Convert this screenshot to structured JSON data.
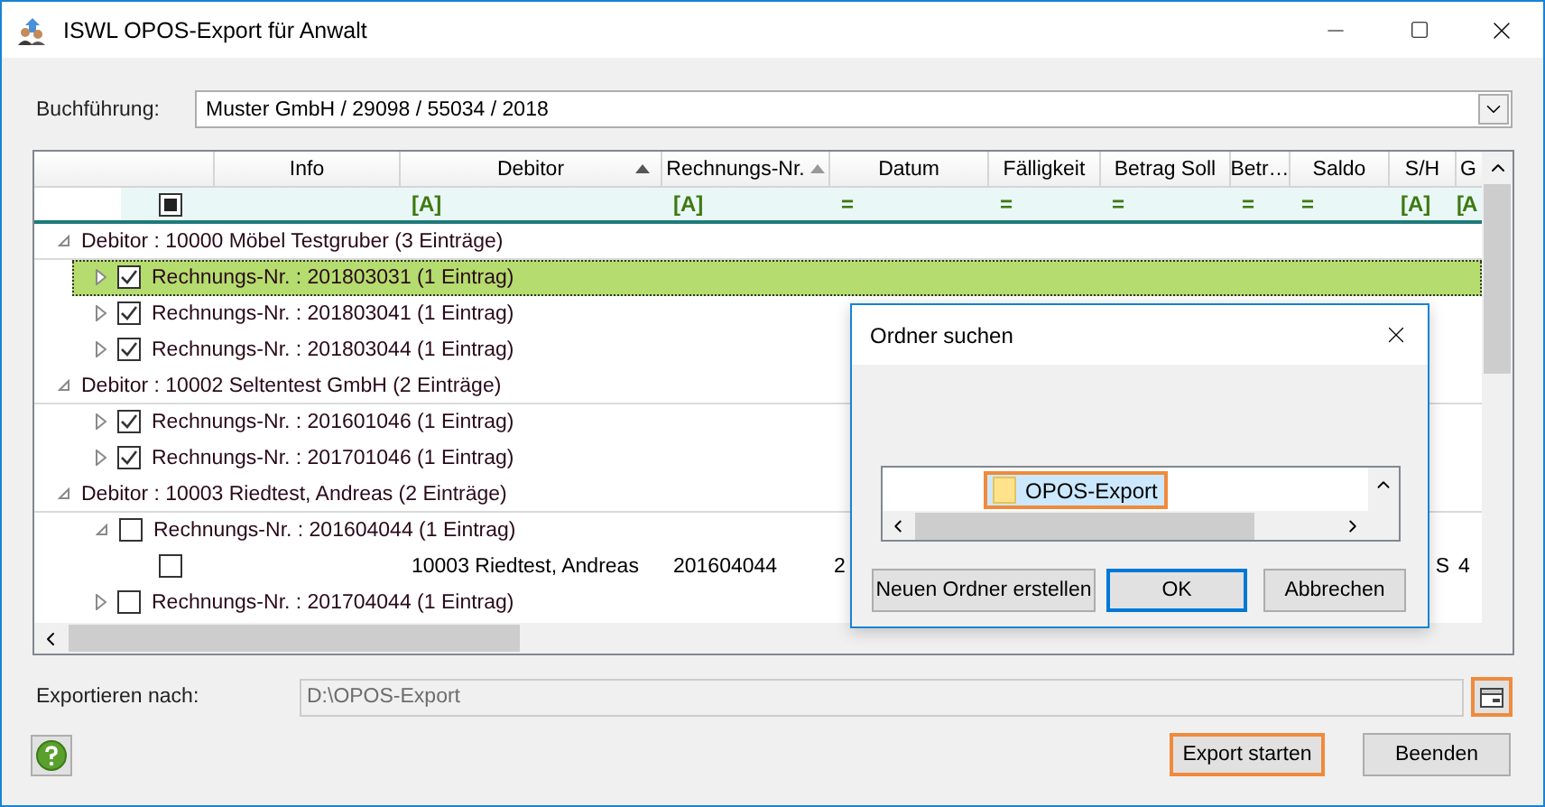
{
  "window": {
    "title": "ISWL OPOS-Export für Anwalt"
  },
  "accounting": {
    "label": "Buchführung:",
    "value": "Muster GmbH / 29098 / 55034 / 2018"
  },
  "grid": {
    "select_all_partial": true,
    "columns": [
      {
        "label": "Info"
      },
      {
        "label": "Debitor",
        "sorted": true,
        "filter": "[A]"
      },
      {
        "label": "Rechnungs-Nr.",
        "sorted": true,
        "filter": "[A]"
      },
      {
        "label": "Datum",
        "filter": "="
      },
      {
        "label": "Fälligkeit",
        "filter": "="
      },
      {
        "label": "Betrag Soll",
        "filter": "="
      },
      {
        "label": "Betr…",
        "filter": "="
      },
      {
        "label": "Saldo",
        "filter": "="
      },
      {
        "label": "S/H",
        "filter": "[A]"
      },
      {
        "label": "G",
        "filter": "[A"
      }
    ],
    "tree": [
      {
        "kind": "group",
        "label": "Debitor : 10000 Möbel Testgruber (3 Einträge)",
        "expanded": true,
        "selected": false,
        "children": [
          {
            "kind": "invoice",
            "label": "Rechnungs-Nr. : 201803031 (1 Eintrag)",
            "expanded": false,
            "checked": true,
            "selected": true
          },
          {
            "kind": "invoice",
            "label": "Rechnungs-Nr. : 201803041 (1 Eintrag)",
            "expanded": false,
            "checked": true,
            "selected": false
          },
          {
            "kind": "invoice",
            "label": "Rechnungs-Nr. : 201803044 (1 Eintrag)",
            "expanded": false,
            "checked": true,
            "selected": false
          }
        ]
      },
      {
        "kind": "group",
        "label": "Debitor : 10002 Seltentest GmbH (2 Einträge)",
        "expanded": true,
        "selected": false,
        "children": [
          {
            "kind": "invoice",
            "label": "Rechnungs-Nr. : 201601046 (1 Eintrag)",
            "expanded": false,
            "checked": true,
            "selected": false
          },
          {
            "kind": "invoice",
            "label": "Rechnungs-Nr. : 201701046 (1 Eintrag)",
            "expanded": false,
            "checked": true,
            "selected": false
          }
        ]
      },
      {
        "kind": "group",
        "label": "Debitor : 10003 Riedtest, Andreas (2 Einträge)",
        "expanded": true,
        "selected": false,
        "children": [
          {
            "kind": "invoice",
            "label": "Rechnungs-Nr. : 201604044 (1 Eintrag)",
            "expanded": true,
            "checked": false,
            "selected": false,
            "children": [
              {
                "kind": "record",
                "checked": false,
                "selected": false,
                "cells": {
                  "debitor": "10003 Riedtest, Andreas",
                  "rechnungs_nr": "201604044",
                  "datum": "2",
                  "s_h": "S",
                  "column_g": "4"
                }
              }
            ]
          },
          {
            "kind": "invoice",
            "label": "Rechnungs-Nr. : 201704044 (1 Eintrag)",
            "expanded": false,
            "checked": false,
            "selected": false
          }
        ]
      }
    ]
  },
  "export": {
    "label": "Exportieren nach:",
    "value": "D:\\OPOS-Export",
    "browse_highlighted": true
  },
  "buttons": [
    {
      "label": "Export starten",
      "highlighted": true
    },
    {
      "label": "Beenden",
      "highlighted": false
    }
  ],
  "dialog": {
    "title": "Ordner suchen",
    "folder": {
      "label": "OPOS-Export",
      "selected": true,
      "highlighted": true
    },
    "buttons": [
      {
        "label": "Neuen Ordner erstellen",
        "default": false
      },
      {
        "label": "OK",
        "default": true
      },
      {
        "label": "Abbrechen",
        "default": false
      }
    ]
  }
}
